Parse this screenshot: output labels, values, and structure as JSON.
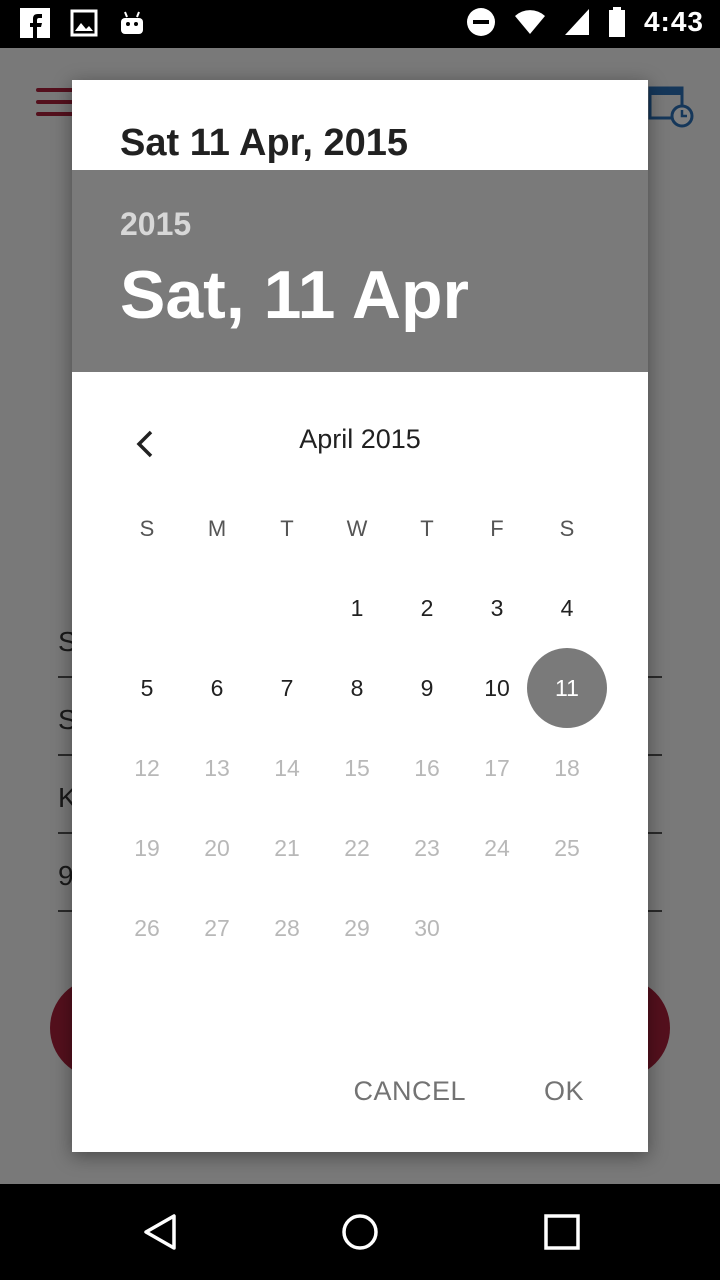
{
  "status_bar": {
    "time": "4:43",
    "left_icons": [
      "facebook-icon",
      "image-icon",
      "android-icon"
    ],
    "right_icons": [
      "do-not-disturb-icon",
      "wifi-icon",
      "signal-icon",
      "battery-icon"
    ]
  },
  "background_app": {
    "fields": [
      "S",
      "S",
      "K",
      "9"
    ]
  },
  "dialog": {
    "title": "Sat 11 Apr, 2015",
    "header": {
      "year": "2015",
      "date": "Sat, 11 Apr"
    },
    "month_label": "April 2015",
    "weekdays": [
      "S",
      "M",
      "T",
      "W",
      "T",
      "F",
      "S"
    ],
    "weeks": [
      [
        "",
        "",
        "",
        "1",
        "2",
        "3",
        "4"
      ],
      [
        "5",
        "6",
        "7",
        "8",
        "9",
        "10",
        "11"
      ],
      [
        "12",
        "13",
        "14",
        "15",
        "16",
        "17",
        "18"
      ],
      [
        "19",
        "20",
        "21",
        "22",
        "23",
        "24",
        "25"
      ],
      [
        "26",
        "27",
        "28",
        "29",
        "30",
        "",
        ""
      ]
    ],
    "selected_day": "11",
    "last_enabled_day": 11,
    "cancel_label": "CANCEL",
    "ok_label": "OK"
  },
  "colors": {
    "header_bg": "#7a7a7a",
    "accent": "#a8213a",
    "disabled_day": "#b8b8b8"
  }
}
